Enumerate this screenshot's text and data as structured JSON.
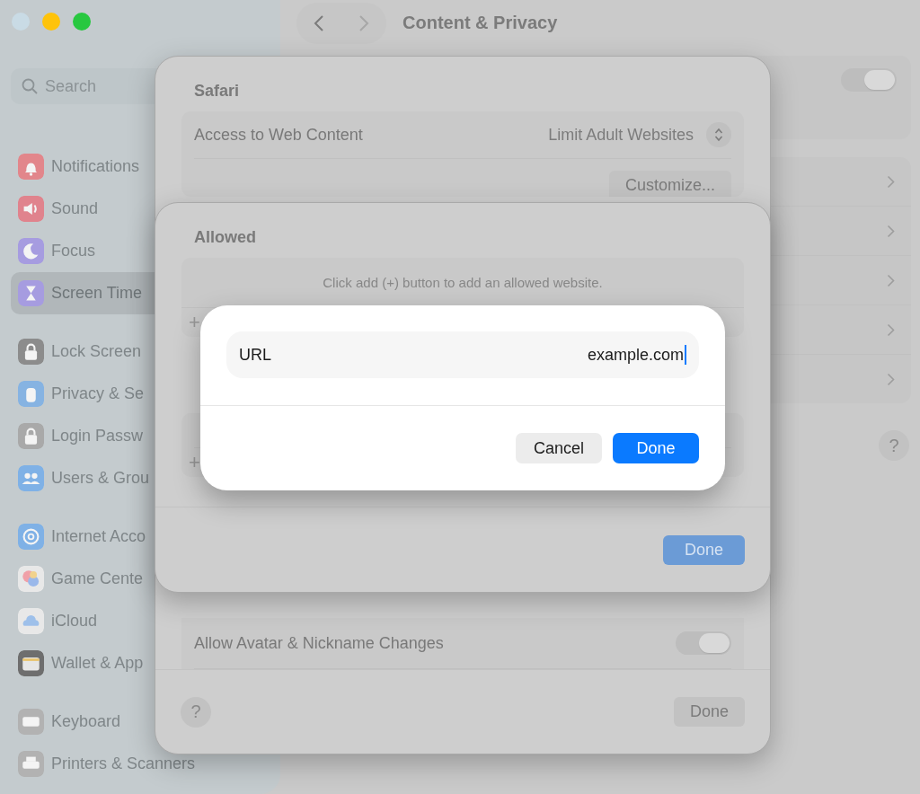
{
  "window": {
    "title": "Content & Privacy",
    "controls": {
      "close": false
    }
  },
  "sidebar": {
    "search": {
      "placeholder": "Search"
    },
    "groups": [
      {
        "items": [
          {
            "label": "Notifications",
            "selected": false,
            "color": "#e2868b"
          },
          {
            "label": "Sound",
            "selected": false,
            "color": "#e0838d"
          },
          {
            "label": "Focus",
            "selected": false,
            "color": "#a69ce0"
          },
          {
            "label": "Screen Time",
            "selected": true,
            "color": "#a69ce0"
          }
        ]
      },
      {
        "items": [
          {
            "label": "Lock Screen",
            "selected": false,
            "color": "#8c8c8c"
          },
          {
            "label": "Privacy & Se",
            "selected": false,
            "color": "#86b3e2"
          },
          {
            "label": "Login Passw",
            "selected": false,
            "color": "#a9a9a9"
          },
          {
            "label": "Users & Grou",
            "selected": false,
            "color": "#7fb1e6"
          }
        ]
      },
      {
        "items": [
          {
            "label": "Internet Acco",
            "selected": false,
            "color": "#7fb1e6"
          },
          {
            "label": "Game Cente",
            "selected": false,
            "color": "#e8e8e8"
          },
          {
            "label": "iCloud",
            "selected": false,
            "color": "#e8e8e8"
          },
          {
            "label": "Wallet & App",
            "selected": false,
            "color": "#6e6e6e"
          }
        ]
      },
      {
        "items": [
          {
            "label": "Keyboard",
            "selected": false,
            "color": "#b2b2b2"
          },
          {
            "label": "Printers & Scanners",
            "selected": false,
            "color": "#b2b2b2"
          }
        ]
      }
    ]
  },
  "main": {
    "top_toggle": {
      "on": true
    }
  },
  "safari_sheet": {
    "title": "Safari",
    "access_label": "Access to Web Content",
    "access_value": "Limit Adult Websites",
    "customize_button": "Customize...",
    "toggle_rows": [
      {
        "label": "Allow Avatar & Nickname Changes",
        "on": true
      }
    ],
    "help": "?",
    "done_button": "Done"
  },
  "allowed_sheet": {
    "title": "Allowed",
    "hint": "Click add (+) button to add an allowed website.",
    "add": "+",
    "second_add": "+",
    "done_button": "Done"
  },
  "url_dialog": {
    "field_label": "URL",
    "field_value": "example.com",
    "cancel_button": "Cancel",
    "done_button": "Done"
  }
}
